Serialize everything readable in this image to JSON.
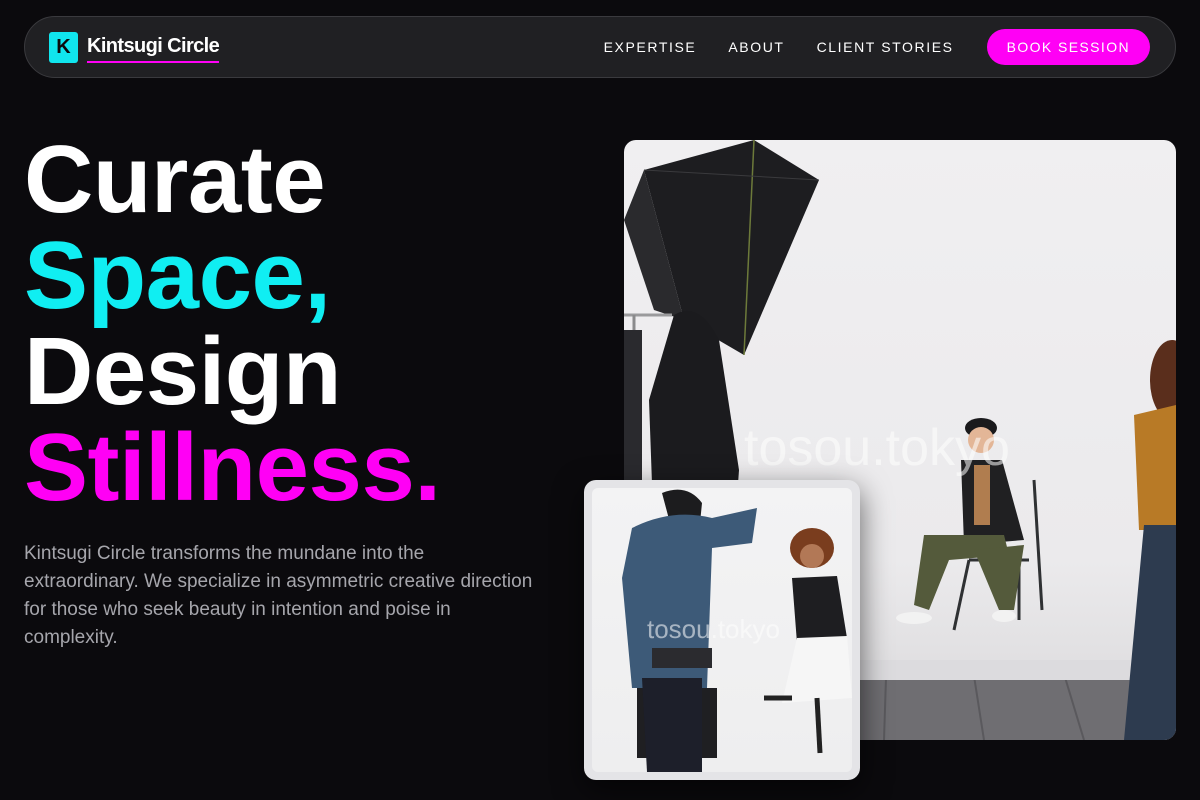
{
  "nav": {
    "logo_letter": "K",
    "brand": "Kintsugi Circle",
    "links": [
      "EXPERTISE",
      "ABOUT",
      "CLIENT STORIES"
    ],
    "cta": "BOOK SESSION"
  },
  "hero": {
    "line1": "Curate",
    "line2": "Space,",
    "line3": "Design",
    "line4": "Stillness.",
    "description": "Kintsugi Circle transforms the mundane into the extraordinary. We specialize in asymmetric creative direction for those who seek beauty in intention and poise in complexity."
  },
  "images": {
    "main_watermark": "tosou.tokyo",
    "small_watermark": "tosou.tokyo"
  },
  "colors": {
    "accent_cyan": "#10eef2",
    "accent_magenta": "#ff00f5",
    "background": "#0b0a0d"
  }
}
